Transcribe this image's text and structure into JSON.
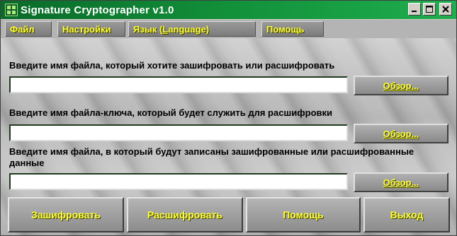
{
  "window": {
    "title": "Signature Cryptographer v1.0",
    "icon": "app-grid-icon",
    "controls": {
      "minimize_icon": "minimize-icon",
      "maximize_icon": "maximize-icon",
      "close_icon": "close-icon"
    }
  },
  "menu": {
    "items": [
      {
        "label": "Файл"
      },
      {
        "label": "Настройки"
      },
      {
        "label_before": "Язык (",
        "label_underlined": "L",
        "label_after": "anguage)"
      },
      {
        "label": "Помощь"
      }
    ]
  },
  "sections": [
    {
      "label": "Введите имя файла, который хотите зашифровать или расшифровать",
      "value": "",
      "browse_label": "Обзор..."
    },
    {
      "label": "Введите имя файла-ключа, который будет служить для расшифровки",
      "value": "",
      "browse_label": "Обзор..."
    },
    {
      "label": "Введите имя файла, в который будут записаны зашифрованные или расшифрованные данные",
      "value": "",
      "browse_label": "Обзор..."
    }
  ],
  "actions": {
    "encrypt": "Зашифровать",
    "decrypt": "Расшифровать",
    "help": "Помощь",
    "exit": "Выход"
  },
  "colors": {
    "title_bar": "#12903a",
    "button_text": "#ffff33",
    "label_text": "#000000"
  }
}
